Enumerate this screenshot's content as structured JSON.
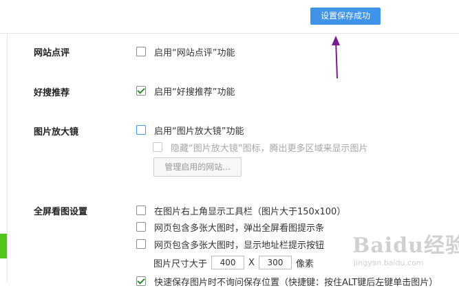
{
  "toast": {
    "text": "设置保存成功"
  },
  "colors": {
    "toast_bg": "#3f93e8",
    "arrow": "#7b1a8c",
    "check": "#2d8a2d",
    "green_marker": "#52c41a"
  },
  "sections": {
    "site_review": {
      "title": "网站点评",
      "option": {
        "label": "启用“网站点评”功能",
        "checked": false
      }
    },
    "hao_sou": {
      "title": "好搜推荐",
      "option": {
        "label": "启用“好搜推荐”功能",
        "checked": true
      }
    },
    "magnifier": {
      "title": "图片放大镜",
      "option": {
        "label": "启用“图片放大镜”功能",
        "checked": false
      },
      "sub_option": {
        "label": "隐藏“图片放大镜”图标，腾出更多区域来显示图片",
        "checked": false,
        "disabled": true
      },
      "manage_button": "管理启用的网站..."
    },
    "fullscreen": {
      "title": "全屏看图设置",
      "options": [
        {
          "label": "在图片右上角显示工具栏（图片大于150x100）",
          "checked": false
        },
        {
          "label": "网页包含多张大图时，弹出全屏看图提示条",
          "checked": false
        },
        {
          "label": "网页包含多张大图时，显示地址栏提示按钮",
          "checked": false
        }
      ],
      "size_row": {
        "prefix": "图片尺寸大于",
        "width": "400",
        "separator": "X",
        "height": "300",
        "unit": "像素"
      },
      "last_option": {
        "label": "快速保存图片时不询问保存位置（快捷键：按住ALT键后左键单击图片）",
        "checked": true
      }
    }
  },
  "watermark": {
    "brand": "Baidu经验",
    "url": "jingyan.baidu.com"
  }
}
